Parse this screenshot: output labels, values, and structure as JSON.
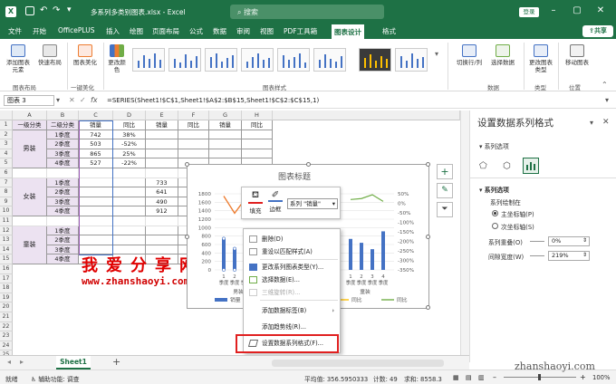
{
  "window": {
    "filename": "多系列多类别图表.xlsx",
    "app": "Excel",
    "search_placeholder": "搜索",
    "login_label": "登录",
    "share_label": "共享"
  },
  "tabs": [
    "文件",
    "开始",
    "OfficePLUS",
    "插入",
    "绘图",
    "页面布局",
    "公式",
    "数据",
    "审阅",
    "视图",
    "PDF工具箱",
    "图表设计",
    "格式"
  ],
  "active_tab": "图表设计",
  "ribbon": {
    "add_element": "添加图表元素",
    "quick_layout": "快速布局",
    "chart_beautify": "图表美化",
    "change_colors": "更改颜色",
    "switch_rowcol": "切换行/列",
    "select_data": "选择数据",
    "change_type": "更改图表类型",
    "move_chart": "移动图表",
    "groups": {
      "layout": "图表布局",
      "beautify": "一键美化",
      "styles": "图表样式",
      "data": "数据",
      "type": "类型",
      "location": "位置"
    }
  },
  "formula": {
    "name_box": "图表 3",
    "fx": "fx",
    "content": "=SERIES(Sheet1!$C$1,Sheet1!$A$2:$B$15,Sheet1!$C$2:$C$15,1)"
  },
  "columns": [
    "A",
    "B",
    "C",
    "D",
    "E",
    "F",
    "G",
    "H"
  ],
  "rows": [
    "1",
    "2",
    "3",
    "4",
    "5",
    "6",
    "7",
    "8",
    "9",
    "10",
    "11",
    "12",
    "13",
    "14",
    "15",
    "16",
    "17",
    "18",
    "19",
    "20",
    "21",
    "22",
    "23",
    "24",
    "25"
  ],
  "table": {
    "headers": [
      "一级分类",
      "二级分类",
      "销量",
      "同比",
      "销量",
      "同比",
      "销量",
      "同比"
    ],
    "groups": [
      "男装",
      "女装",
      "童装"
    ],
    "quarters": [
      "1季度",
      "2季度",
      "3季度",
      "4季度"
    ],
    "c_values": [
      "742",
      "503",
      "865",
      "527"
    ],
    "d_values": [
      "38%",
      "-52%",
      "25%",
      "-22%"
    ],
    "e_values": [
      "733",
      "641",
      "490",
      "912"
    ]
  },
  "chart": {
    "title": "图表标题",
    "y_left": [
      "1800",
      "1600",
      "1400",
      "1200",
      "1000",
      "800",
      "600",
      "400",
      "200",
      "0"
    ],
    "y_right": [
      "50%",
      "0%",
      "-50%",
      "-100%",
      "-150%",
      "-200%",
      "-250%",
      "-300%",
      "-350%"
    ],
    "x_labels": [
      "1季度",
      "2季度",
      "3季度",
      "4季度"
    ],
    "group_labels": [
      "男装",
      "童装"
    ],
    "legend": [
      "销量",
      "同比",
      "同比",
      "同比"
    ],
    "colors": {
      "bar": "#4472c4",
      "line1": "#ed7d31",
      "line2": "#ffc000",
      "line3": "#70ad47"
    }
  },
  "chart_data": {
    "type": "bar",
    "title": "图表标题",
    "categories": [
      "男装-1季度",
      "男装-2季度",
      "男装-3季度",
      "男装-4季度",
      "女装-1季度",
      "女装-2季度",
      "女装-3季度",
      "女装-4季度"
    ],
    "series": [
      {
        "name": "销量",
        "values": [
          742,
          503,
          865,
          527,
          733,
          641,
          490,
          912
        ]
      },
      {
        "name": "同比",
        "values": [
          0.38,
          -0.52,
          0.25,
          -0.22
        ]
      }
    ],
    "ylim": [
      0,
      1800
    ],
    "y2lim": [
      -3.5,
      0.5
    ],
    "grid": true,
    "legend": "bottom"
  },
  "mini_toolbar": {
    "fill": "填充",
    "outline": "边框",
    "series_select": "系列 \"销量\""
  },
  "context_menu": {
    "items": [
      "删除(D)",
      "重设以匹配样式(A)",
      "更改系列图表类型(Y)...",
      "选择数据(E)...",
      "三维旋转(R)...",
      "添加数据标签(B)",
      "添加趋势线(R)...",
      "设置数据系列格式(F)..."
    ]
  },
  "pane": {
    "title": "设置数据系列格式",
    "options_label": "系列选项",
    "section": "系列选项",
    "plot_on": "系列绘制在",
    "primary_axis": "主坐标轴(P)",
    "secondary_axis": "次坐标轴(S)",
    "overlap_label": "系列重叠(O)",
    "overlap_value": "0%",
    "gap_label": "间隙宽度(W)",
    "gap_value": "219%"
  },
  "sheet": {
    "tab": "Sheet1",
    "add": "+"
  },
  "status": {
    "ready": "就绪",
    "accessibility": "辅助功能: 调查",
    "average": "平均值: 356.5950333",
    "count": "计数: 49",
    "sum": "求和: 8558.3",
    "zoom": "100%"
  },
  "watermark": {
    "cn": "我爱分享网",
    "url": "www.zhanshaoyi.com",
    "corner": "zhanshaoyi.com"
  }
}
